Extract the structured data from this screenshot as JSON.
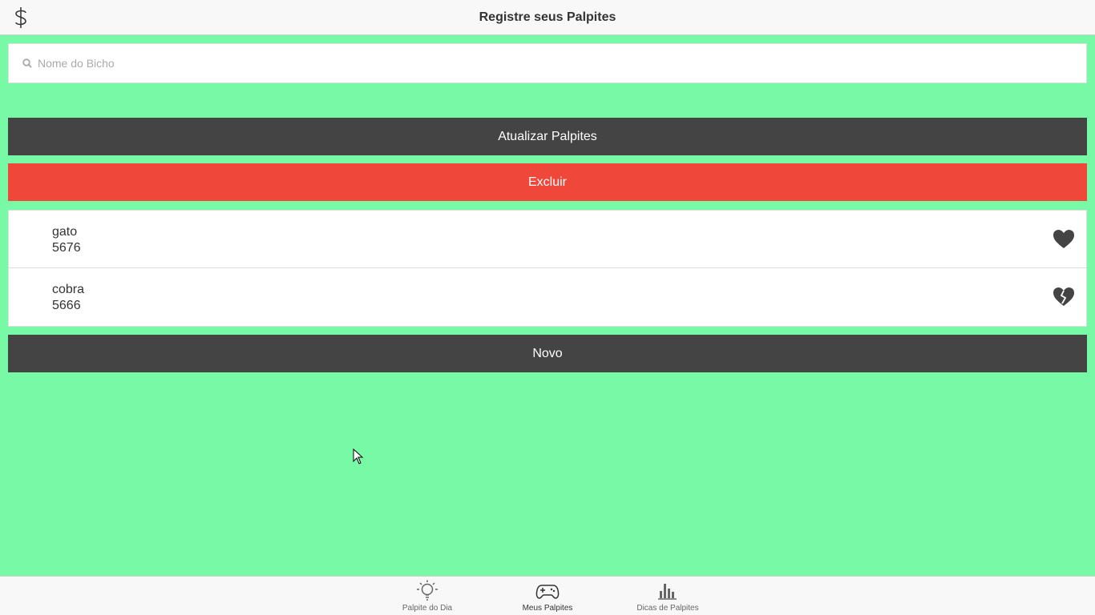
{
  "header": {
    "title": "Registre seus Palpites",
    "logo_icon": "dollar-sign-icon"
  },
  "search": {
    "placeholder": "Nome do Bicho",
    "value": "",
    "icon": "search-icon"
  },
  "buttons": {
    "update": "Atualizar Palpites",
    "delete": "Excluir",
    "new": "Novo"
  },
  "guesses": [
    {
      "name": "gato",
      "number": "5676",
      "icon": "heart-icon"
    },
    {
      "name": "cobra",
      "number": "5666",
      "icon": "broken-heart-icon"
    }
  ],
  "tabs": [
    {
      "label": "Palpite do Dia",
      "icon": "lightbulb-icon",
      "active": false
    },
    {
      "label": "Meus Palpites",
      "icon": "gamepad-icon",
      "active": true
    },
    {
      "label": "Dicas de Palpites",
      "icon": "bar-chart-icon",
      "active": false
    }
  ],
  "colors": {
    "background": "#77f9a6",
    "dark_button": "#444444",
    "danger_button": "#ef473a"
  }
}
